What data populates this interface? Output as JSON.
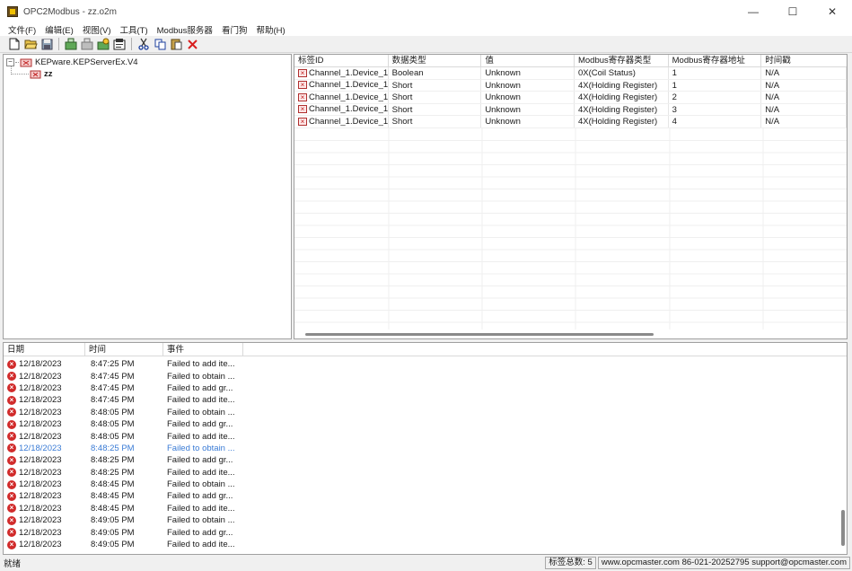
{
  "window": {
    "title": "OPC2Modbus - zz.o2m",
    "minimize_glyph": "—",
    "maximize_glyph": "☐",
    "close_glyph": "✕"
  },
  "menu": [
    "文件(F)",
    "编辑(E)",
    "视图(V)",
    "工具(T)",
    "Modbus服务器",
    "看门狗",
    "帮助(H)"
  ],
  "toolbar": {
    "icons": [
      "new-file-icon",
      "open-folder-icon",
      "save-icon",
      "add-server-icon",
      "add-group-icon",
      "add-item-icon",
      "properties-icon",
      "cut-icon",
      "copy-icon",
      "paste-icon",
      "delete-icon"
    ]
  },
  "tree": {
    "server_label": "KEPware.KEPServerEx.V4",
    "group_label": "zz",
    "expander_glyph": "−"
  },
  "tag_grid": {
    "columns": [
      "标签ID",
      "数据类型",
      "值",
      "Modbus寄存器类型",
      "Modbus寄存器地址",
      "时间戳"
    ],
    "rows": [
      [
        "Channel_1.Device_1...",
        "Boolean",
        "Unknown",
        "0X(Coil Status)",
        "1",
        "N/A"
      ],
      [
        "Channel_1.Device_1...",
        "Short",
        "Unknown",
        "4X(Holding Register)",
        "1",
        "N/A"
      ],
      [
        "Channel_1.Device_1...",
        "Short",
        "Unknown",
        "4X(Holding Register)",
        "2",
        "N/A"
      ],
      [
        "Channel_1.Device_1...",
        "Short",
        "Unknown",
        "4X(Holding Register)",
        "3",
        "N/A"
      ],
      [
        "Channel_1.Device_1...",
        "Short",
        "Unknown",
        "4X(Holding Register)",
        "4",
        "N/A"
      ]
    ]
  },
  "log": {
    "columns": [
      "日期",
      "时间",
      "事件"
    ],
    "selected_index": 7,
    "rows": [
      [
        "12/18/2023",
        "8:47:25 PM",
        "Failed to add ite..."
      ],
      [
        "12/18/2023",
        "8:47:45 PM",
        "Failed to obtain ..."
      ],
      [
        "12/18/2023",
        "8:47:45 PM",
        "Failed to add gr..."
      ],
      [
        "12/18/2023",
        "8:47:45 PM",
        "Failed to add ite..."
      ],
      [
        "12/18/2023",
        "8:48:05 PM",
        "Failed to obtain ..."
      ],
      [
        "12/18/2023",
        "8:48:05 PM",
        "Failed to add gr..."
      ],
      [
        "12/18/2023",
        "8:48:05 PM",
        "Failed to add ite..."
      ],
      [
        "12/18/2023",
        "8:48:25 PM",
        "Failed to obtain ..."
      ],
      [
        "12/18/2023",
        "8:48:25 PM",
        "Failed to add gr..."
      ],
      [
        "12/18/2023",
        "8:48:25 PM",
        "Failed to add ite..."
      ],
      [
        "12/18/2023",
        "8:48:45 PM",
        "Failed to obtain ..."
      ],
      [
        "12/18/2023",
        "8:48:45 PM",
        "Failed to add gr..."
      ],
      [
        "12/18/2023",
        "8:48:45 PM",
        "Failed to add ite..."
      ],
      [
        "12/18/2023",
        "8:49:05 PM",
        "Failed to obtain ..."
      ],
      [
        "12/18/2023",
        "8:49:05 PM",
        "Failed to add gr..."
      ],
      [
        "12/18/2023",
        "8:49:05 PM",
        "Failed to add ite..."
      ]
    ]
  },
  "status": {
    "ready": "就绪",
    "tag_count": "标签总数: 5",
    "contact": "www.opcmaster.com 86-021-20252795 support@opcmaster.com"
  },
  "colors": {
    "error": "#d12b2b",
    "selected_text": "#3a7bd5"
  }
}
